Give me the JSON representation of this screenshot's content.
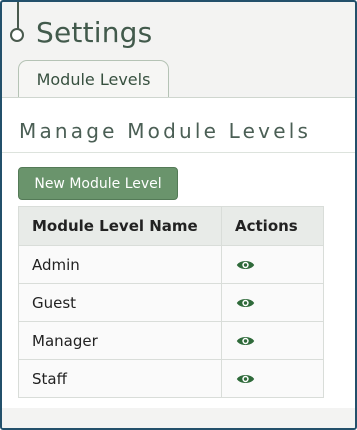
{
  "page": {
    "title": "Settings"
  },
  "tabs": [
    {
      "label": "Module Levels",
      "active": true
    }
  ],
  "section": {
    "title": "Manage Module Levels"
  },
  "toolbar": {
    "new_label": "New Module Level"
  },
  "table": {
    "headers": [
      "Module Level Name",
      "Actions"
    ],
    "rows": [
      {
        "name": "Admin",
        "action_icon": "eye-icon"
      },
      {
        "name": "Guest",
        "action_icon": "eye-icon"
      },
      {
        "name": "Manager",
        "action_icon": "eye-icon"
      },
      {
        "name": "Staff",
        "action_icon": "eye-icon"
      }
    ]
  },
  "colors": {
    "accent": "#6a946c",
    "title": "#425a4c",
    "icon": "#2f6a3a",
    "frame": "#23506b"
  }
}
